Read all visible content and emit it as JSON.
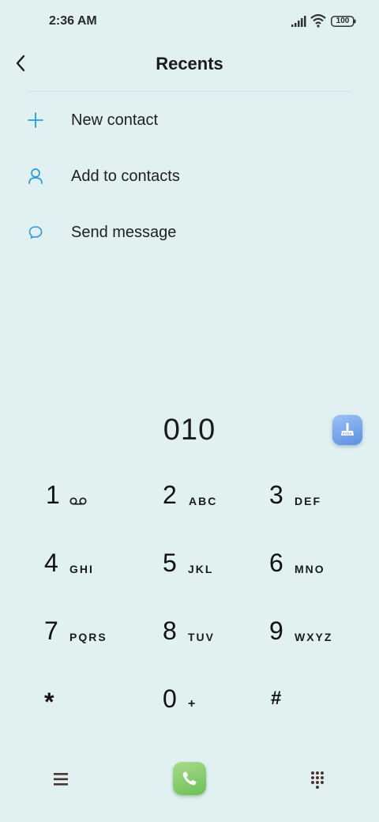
{
  "status_bar": {
    "time": "2:36 AM",
    "battery": "100",
    "icons": [
      "signal-icon",
      "wifi-icon",
      "battery-icon"
    ]
  },
  "header": {
    "title": "Recents",
    "back_icon": "chevron-left-icon"
  },
  "actions": [
    {
      "label": "New contact",
      "icon": "plus-icon"
    },
    {
      "label": "Add to contacts",
      "icon": "person-icon"
    },
    {
      "label": "Send message",
      "icon": "message-bubble-icon"
    }
  ],
  "dialer": {
    "number": "010",
    "cleaner_icon": "broom-icon"
  },
  "keypad": [
    {
      "digit": "1",
      "letters": "",
      "icon": "voicemail-icon"
    },
    {
      "digit": "2",
      "letters": "ABC"
    },
    {
      "digit": "3",
      "letters": "DEF"
    },
    {
      "digit": "4",
      "letters": "GHI"
    },
    {
      "digit": "5",
      "letters": "JKL"
    },
    {
      "digit": "6",
      "letters": "MNO"
    },
    {
      "digit": "7",
      "letters": "PQRS"
    },
    {
      "digit": "8",
      "letters": "TUV"
    },
    {
      "digit": "9",
      "letters": "WXYZ"
    },
    {
      "digit": "*",
      "letters": ""
    },
    {
      "digit": "0",
      "letters": "+"
    },
    {
      "digit": "#",
      "letters": ""
    }
  ],
  "bottom_bar": {
    "menu_icon": "hamburger-menu-icon",
    "call_icon": "phone-icon",
    "dialpad_icon": "dialpad-icon"
  },
  "colors": {
    "background": "#e1f0f1",
    "accent_blue": "#2b9be0",
    "call_green": "#6cbf57",
    "cleaner_blue": "#5c8fe2",
    "bottom_icon_brown": "#4a3530"
  }
}
